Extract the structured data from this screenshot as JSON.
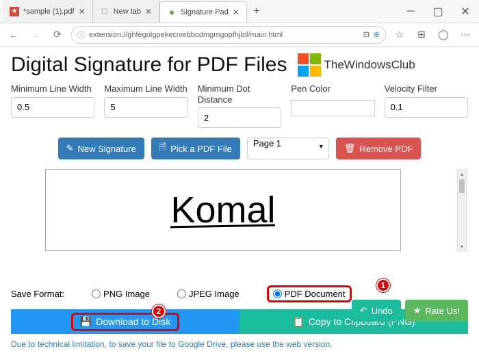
{
  "tabs": [
    {
      "label": "*sample (1).pdf",
      "icon_color": "#d04b3b"
    },
    {
      "label": "New tab",
      "icon_color": "#888"
    },
    {
      "label": "Signature Pad",
      "icon_color": "#6aa84f"
    }
  ],
  "url": {
    "scheme_icon": "ⓘ",
    "text": "extension://ghfegolgpekecniebbodmgmgopfhjlol/main.html"
  },
  "page": {
    "title": "Digital Signature for PDF Files",
    "logo_text": "TheWindowsClub",
    "controls": {
      "min_line_width": {
        "label": "Minimum Line Width",
        "value": "0.5"
      },
      "max_line_width": {
        "label": "Maximum Line Width",
        "value": "5"
      },
      "min_dot_distance": {
        "label": "Minimum Dot Distance",
        "value": "2"
      },
      "pen_color": {
        "label": "Pen Color",
        "value": "#8b0000"
      },
      "velocity_filter": {
        "label": "Velocity Filter",
        "value": "0.1"
      }
    },
    "buttons": {
      "new_signature": "New Signature",
      "pick_pdf": "Pick a PDF File",
      "page_select": "Page 1",
      "remove_pdf": "Remove PDF",
      "undo": "Undo",
      "rate_us": "Rate Us!"
    },
    "signature_text": "Komal",
    "save_format_label": "Save Format:",
    "formats": {
      "png": "PNG Image",
      "jpeg": "JPEG Image",
      "pdf": "PDF Document"
    },
    "download_label": "Download to Disk",
    "copy_label": "Copy to Clipboard (PNG)",
    "note": "Due to technical limitation, to save your file to Google Drive, please use the web version."
  },
  "callouts": {
    "one": "1",
    "two": "2"
  }
}
